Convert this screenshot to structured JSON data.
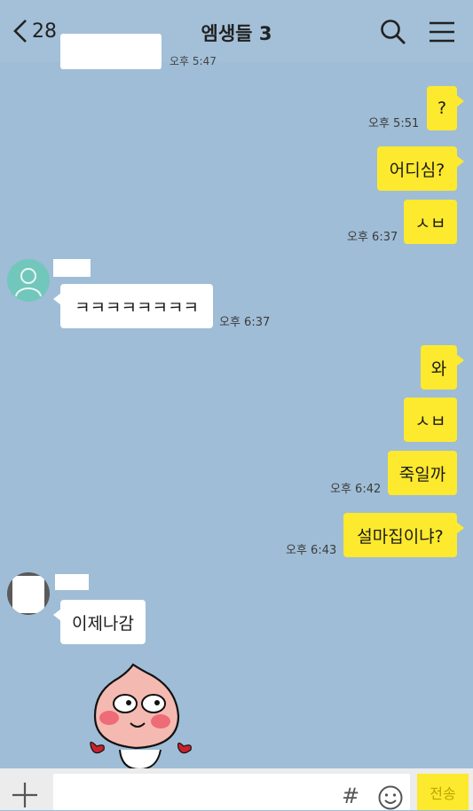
{
  "header": {
    "back_count": "28",
    "title": "엠생들 3"
  },
  "chat": {
    "partial_time": "오후 5:47",
    "messages": [
      {
        "text": "?",
        "time": "오후 5:51"
      },
      {
        "text": "어디심?"
      },
      {
        "text": "ㅅㅂ",
        "time": "오후 6:37"
      },
      {
        "text": "ㅋㅋㅋㅋㅋㅋㅋㅋ",
        "time": "오후 6:37"
      },
      {
        "text": "와"
      },
      {
        "text": "ㅅㅂ"
      },
      {
        "text": "죽일까",
        "time": "오후 6:42"
      },
      {
        "text": "설마집이냐?",
        "time": "오후 6:43"
      },
      {
        "text": "이제나감"
      }
    ]
  },
  "input": {
    "hash": "#",
    "send_label": "전송"
  },
  "colors": {
    "background": "#9fbdd6",
    "my_bubble": "#fde92e",
    "their_bubble": "#ffffff"
  },
  "icons": [
    "chevron-left-icon",
    "search-icon",
    "menu-icon",
    "default-avatar-icon",
    "peach-sticker",
    "plus-icon",
    "emoji-icon"
  ]
}
